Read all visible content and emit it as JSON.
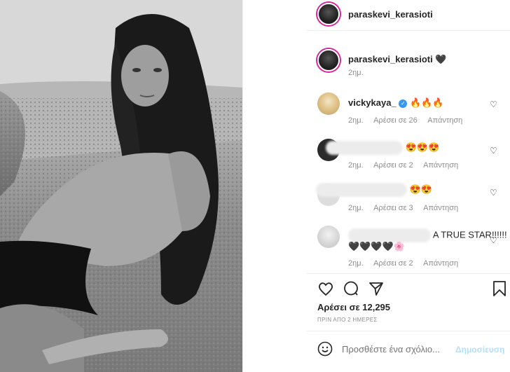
{
  "header": {
    "username": "paraskevi_kerasioti"
  },
  "caption": {
    "username": "paraskevi_kerasioti",
    "text": "🖤",
    "time": "2ημ."
  },
  "comments": [
    {
      "username": "vickykaya_",
      "verified": true,
      "text": "🔥🔥🔥",
      "time": "2ημ.",
      "likes": "Αρέσει σε 26",
      "reply": "Απάντηση"
    },
    {
      "username": "",
      "text": "😍😍😍",
      "time": "2ημ.",
      "likes": "Αρέσει σε 2",
      "reply": "Απάντηση"
    },
    {
      "username": "",
      "text": "😍😍",
      "time": "2ημ.",
      "likes": "Αρέσει σε 3",
      "reply": "Απάντηση"
    },
    {
      "username": "",
      "text": "A TRUE STAR!!!!!!",
      "text2": "🖤🖤🖤🖤🌸",
      "time": "2ημ.",
      "likes": "Αρέσει σε 2",
      "reply": "Απάντηση"
    }
  ],
  "post": {
    "likes": "Αρέσει σε 12,295",
    "date": "ΠΡΙΝ ΑΠΟ 2 ΗΜΕΡΕΣ"
  },
  "comment_box": {
    "placeholder": "Προσθέστε ένα σχόλιο...",
    "post_label": "Δημοσίευση"
  },
  "icons": [
    "heart-icon",
    "comment-icon",
    "share-icon",
    "bookmark-icon",
    "smile-icon"
  ],
  "colors": {
    "accent": "#0095f6",
    "post_disabled": "#b2dffc",
    "muted": "#8e8e8e"
  }
}
